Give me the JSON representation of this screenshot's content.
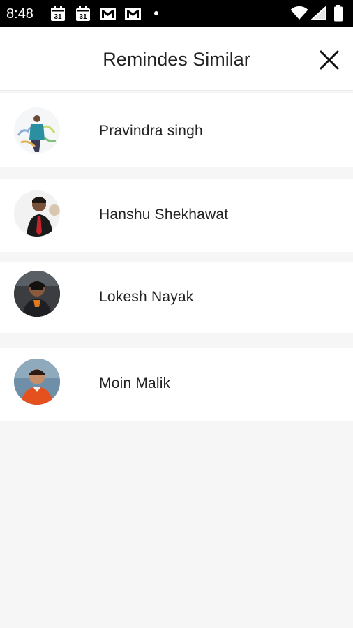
{
  "status_bar": {
    "time": "8:48",
    "calendar_day_1": "31",
    "calendar_day_2": "31",
    "icons": [
      "calendar-icon",
      "calendar-icon",
      "gmail-icon",
      "gmail-icon",
      "dot-icon",
      "wifi-icon",
      "signal-icon",
      "battery-icon"
    ]
  },
  "header": {
    "title": "Remindes Similar",
    "close_icon": "close-icon"
  },
  "contacts": [
    {
      "name": "Pravindra singh"
    },
    {
      "name": "Hanshu Shekhawat"
    },
    {
      "name": "Lokesh Nayak"
    },
    {
      "name": "Moin Malik"
    }
  ],
  "colors": {
    "status_bar_bg": "#000000",
    "page_bg": "#f6f6f6",
    "row_bg": "#ffffff",
    "text": "#222222"
  }
}
